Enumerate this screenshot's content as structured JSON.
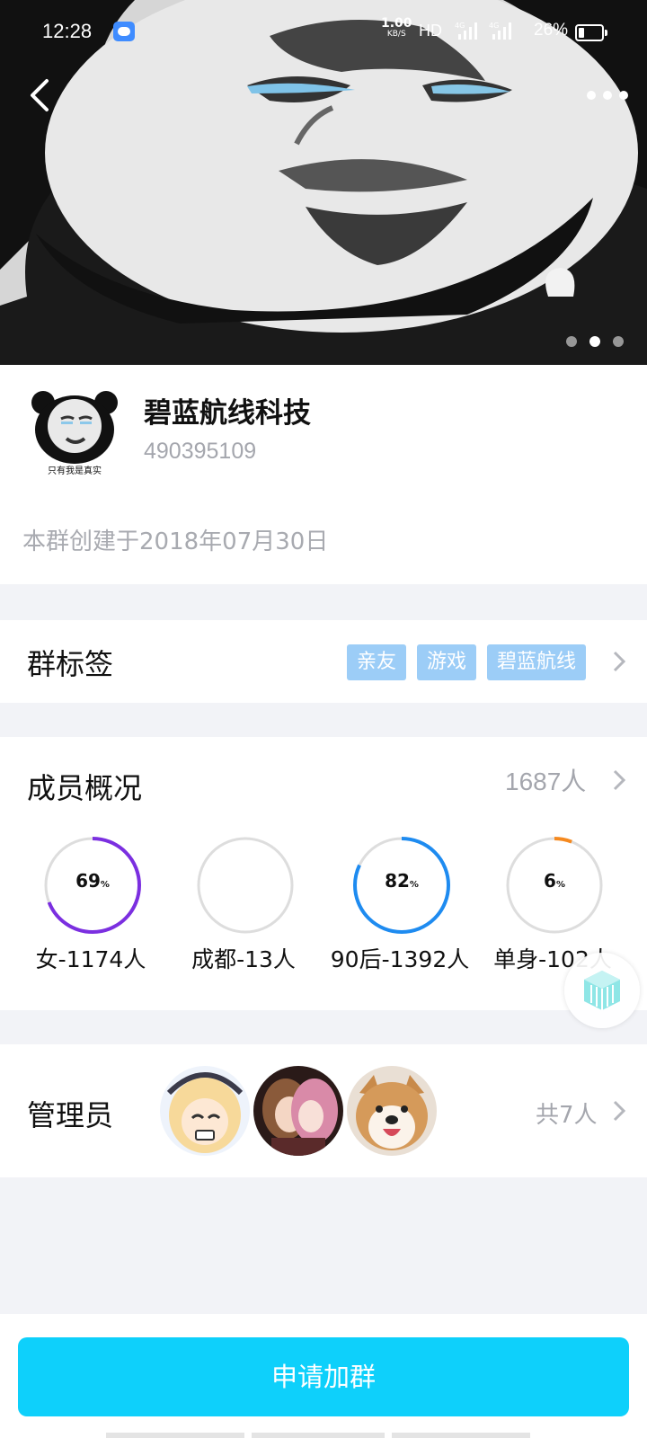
{
  "status_bar": {
    "time": "12:28",
    "net_rate": "1.00",
    "net_rate_unit": "KB/S",
    "hd": "HD",
    "signal1": "4G",
    "signal2": "4G",
    "battery": "26%"
  },
  "banner": {
    "page_count": 3,
    "active_page": 2,
    "icons": [
      "back-icon",
      "more-icon"
    ]
  },
  "group": {
    "name": "碧蓝航线科技",
    "id": "490395109",
    "avatar_caption": "只有我是真实",
    "created": "本群创建于2018年07月30日"
  },
  "tags": {
    "title": "群标签",
    "items": [
      "亲友",
      "游戏",
      "碧蓝航线"
    ]
  },
  "members": {
    "title": "成员概况",
    "count": "1687人",
    "stats": [
      {
        "percent": "69",
        "percent_sign": "%",
        "label": "女-1174人",
        "value": 0.69,
        "color": "#7b2fe0"
      },
      {
        "percent": "",
        "percent_sign": "",
        "label": "成都-13人",
        "value": 0,
        "color": "#dddddd"
      },
      {
        "percent": "82",
        "percent_sign": "%",
        "label": "90后-1392人",
        "value": 0.82,
        "color": "#1e8bf0"
      },
      {
        "percent": "6",
        "percent_sign": "%",
        "label": "单身-102人",
        "value": 0.06,
        "color": "#f5891f"
      }
    ]
  },
  "admins": {
    "title": "管理员",
    "count": "共7人"
  },
  "join_button": "申请加群",
  "colors": {
    "accent": "#0ed0fb",
    "tag_bg": "#9ccdf7",
    "muted_text": "#a4a6ad",
    "page_bg": "#f2f3f7"
  }
}
